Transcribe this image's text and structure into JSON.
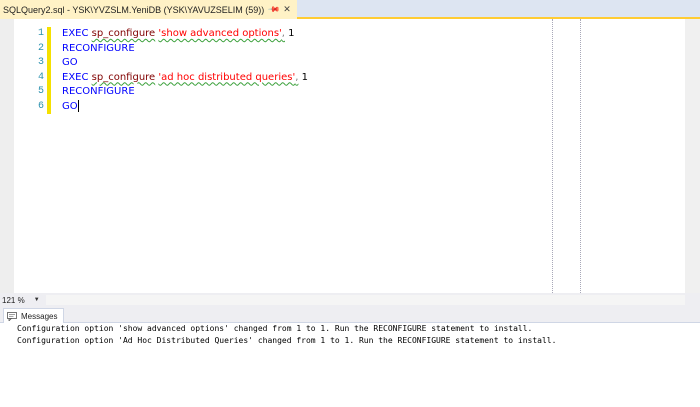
{
  "tab": {
    "title": "SQLQuery2.sql - YSK\\YVZSLM.YeniDB (YSK\\YAVUZSELIM (59))",
    "pin_glyph": "📌",
    "close_glyph": "✕"
  },
  "editor": {
    "line_numbers": [
      "1",
      "2",
      "3",
      "4",
      "5",
      "6"
    ],
    "lines": [
      [
        {
          "t": "EXEC",
          "c": "kw"
        },
        {
          "t": " ",
          "c": ""
        },
        {
          "t": "sp_configure",
          "c": "fn",
          "squig": true
        },
        {
          "t": " ",
          "c": ""
        },
        {
          "t": "'show advanced options'",
          "c": "str",
          "squig": true
        },
        {
          "t": ",",
          "c": "pl",
          "squig": true
        },
        {
          "t": " 1",
          "c": ""
        }
      ],
      [
        {
          "t": "RECONFIGURE",
          "c": "kw"
        }
      ],
      [
        {
          "t": "GO",
          "c": "kw"
        }
      ],
      [
        {
          "t": "EXEC",
          "c": "kw"
        },
        {
          "t": " ",
          "c": ""
        },
        {
          "t": "sp_configure",
          "c": "fn",
          "squig": true
        },
        {
          "t": " ",
          "c": ""
        },
        {
          "t": "'ad hoc distributed queries'",
          "c": "str",
          "squig": true
        },
        {
          "t": ",",
          "c": "pl",
          "squig": true
        },
        {
          "t": " 1",
          "c": ""
        }
      ],
      [
        {
          "t": "RECONFIGURE",
          "c": "kw"
        }
      ],
      [
        {
          "t": "GO",
          "c": "kw"
        }
      ]
    ]
  },
  "statusbar": {
    "zoom": "121 %",
    "zoom_arrow": "▼"
  },
  "results": {
    "tab_label": "Messages",
    "messages": [
      "Configuration option 'show advanced options' changed from 1 to 1. Run the RECONFIGURE statement to install.",
      "Configuration option 'Ad Hoc Distributed Queries' changed from 1 to 1. Run the RECONFIGURE statement to install."
    ]
  },
  "colors": {
    "keyword": "#0000ff",
    "function": "#800000",
    "string": "#ff0000",
    "line_number": "#2b91af",
    "active_tab": "#fff2c6",
    "change_bar": "#f5e000"
  }
}
